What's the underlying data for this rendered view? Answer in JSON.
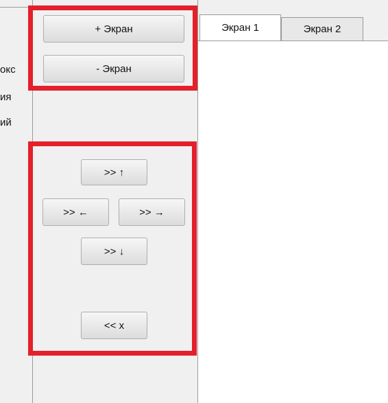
{
  "left_partial_labels": [
    "окс",
    "ия",
    "ий"
  ],
  "screen_buttons": {
    "add_label": "+ Экран",
    "remove_label": "- Экран"
  },
  "nav_buttons": {
    "up_label": ">> ↑",
    "left_label": ">> ←",
    "right_label": ">> →",
    "down_label": ">> ↓",
    "close_label": "<< x"
  },
  "tabs": [
    {
      "label": "Экран 1",
      "active": true
    },
    {
      "label": "Экран 2",
      "active": false
    }
  ],
  "colors": {
    "highlight": "#e3202b",
    "panel_bg": "#f0f0f0",
    "content_bg": "#ffffff"
  }
}
